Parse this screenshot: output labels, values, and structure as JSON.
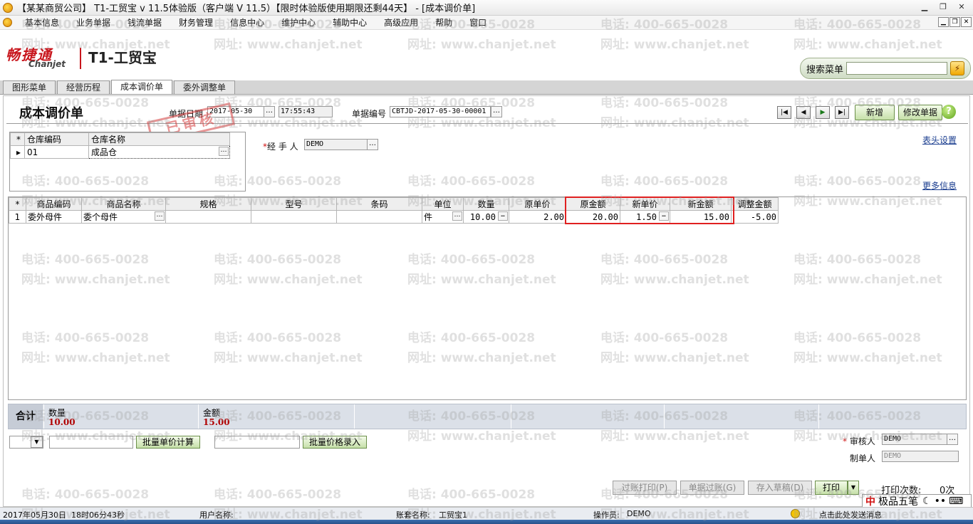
{
  "window": {
    "title": "【某某商贸公司】 T1-工贸宝 v 11.5体验版（客户端 V 11.5）【限时体验版使用期限还剩44天】 - [成本调价单]"
  },
  "menu": [
    "基本信息",
    "业务单据",
    "钱流单据",
    "财务管理",
    "信息中心",
    "维护中心",
    "辅助中心",
    "高级应用",
    "帮助",
    "窗口"
  ],
  "logo": {
    "cn": "畅捷通",
    "en": "Chanjet",
    "product": "T1-工贸宝"
  },
  "search": {
    "label": "搜索菜单",
    "go_icon": "⚡"
  },
  "tabs": [
    "图形菜单",
    "经营历程",
    "成本调价单",
    "委外调整单"
  ],
  "form": {
    "title": "成本调价单",
    "date_label": "单据日期",
    "date": "2017-05-30",
    "time": "17:55:43",
    "number_label": "单据编号",
    "number": "CBTJD-2017-05-30-00001",
    "stamp": "已审核",
    "handler_label": "经 手 人",
    "handler": "DEMO",
    "header_settings": "表头设置",
    "more_info": "更多信息",
    "add_button": "新增",
    "edit_button": "修改单据"
  },
  "warehouse": {
    "headers": [
      "仓库编码",
      "仓库名称"
    ],
    "rows": [
      [
        "01",
        "成品仓"
      ]
    ]
  },
  "grid": {
    "headers": [
      "商品编码",
      "商品名称",
      "规格",
      "型号",
      "条码",
      "单位",
      "数量",
      "原单价",
      "原金额",
      "新单价",
      "新金额",
      "调整金额"
    ],
    "rows": [
      {
        "index": "1",
        "code": "委外母件",
        "name": "委个母件",
        "spec": "",
        "model": "",
        "barcode": "",
        "unit": "件",
        "qty": "10.00",
        "old_price": "2.00",
        "old_amount": "20.00",
        "new_price": "1.50",
        "new_amount": "15.00",
        "adjust": "-5.00"
      }
    ]
  },
  "totals": {
    "label": "合计",
    "qty_label": "数量",
    "qty": "10.00",
    "amount_label": "金额",
    "amount": "15.00"
  },
  "batch": {
    "calc_button": "批量单价计算",
    "price_button": "批量价格录入"
  },
  "approval": {
    "auditor_label": "审核人",
    "auditor": "DEMO",
    "maker_label": "制单人",
    "maker": "DEMO"
  },
  "actions": {
    "post_print": "过账打印(P)",
    "post": "单据过账(G)",
    "draft": "存入草稿(D)",
    "print": "打印",
    "print_count_label": "打印次数:",
    "print_count": "0次"
  },
  "status": {
    "date": "2017年05月30日",
    "time": "18时06分43秒",
    "user_label": "用户名称:",
    "account_label": "账套名称:",
    "account": "工贸宝1",
    "operator_label": "操作员:",
    "operator": "DEMO",
    "message": "点击此处发送消息"
  },
  "ime": {
    "zh": "中",
    "name": "极品五笔"
  },
  "watermark": {
    "phone": "电话: 400-665-0028",
    "site": "网址: www.chanjet.net"
  }
}
